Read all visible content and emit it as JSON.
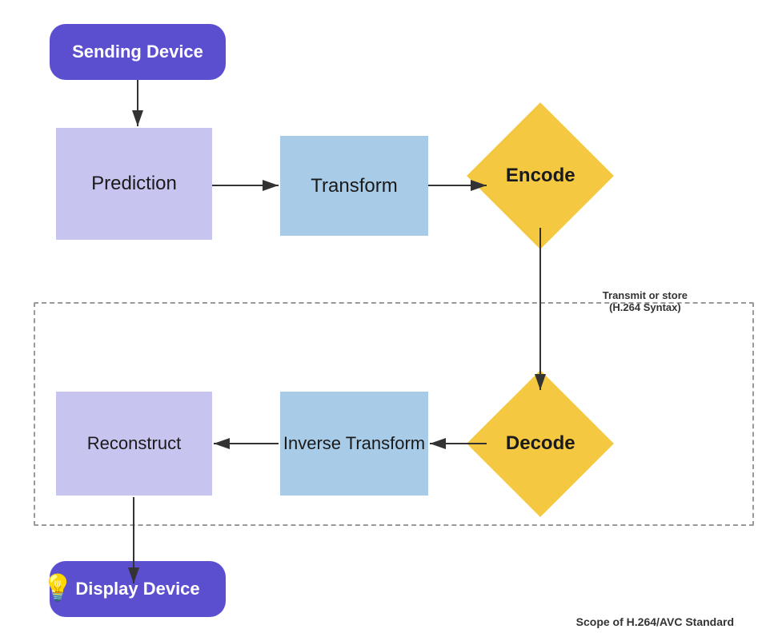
{
  "nodes": {
    "sending_device": "Sending Device",
    "display_device": "Display Device",
    "prediction": "Prediction",
    "transform": "Transform",
    "encode": "Encode",
    "decode": "Decode",
    "inverse_transform": "Inverse Transform",
    "reconstruct": "Reconstruct"
  },
  "labels": {
    "transmit": "Transmit or store\n(H.264 Syntax)",
    "scope": "Scope of H.264/AVC Standard"
  },
  "colors": {
    "purple_node": "#5b4fcf",
    "light_purple": "#c8c4f0",
    "light_blue": "#a8cce8",
    "yellow": "#f5c842",
    "white": "#ffffff",
    "dashed_border": "#999999"
  }
}
